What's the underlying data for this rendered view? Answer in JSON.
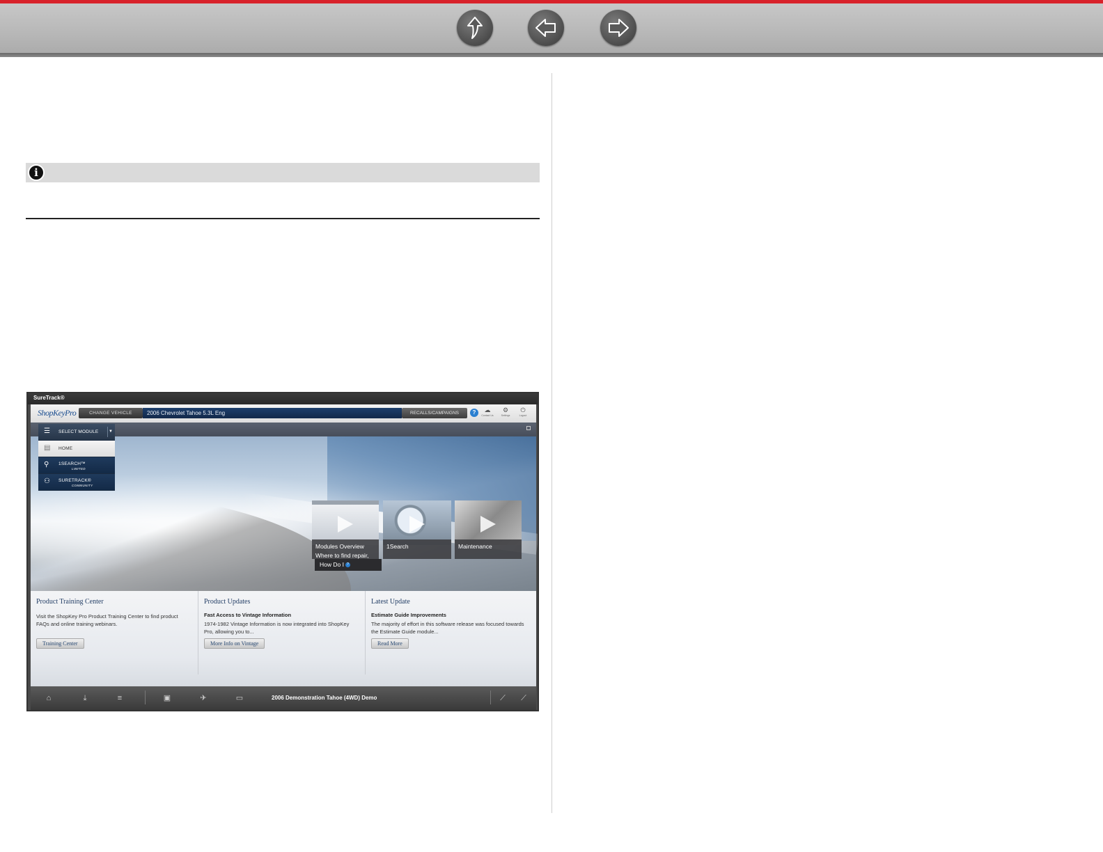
{
  "nav": {
    "up_icon": "up-arrow-icon",
    "back_icon": "left-arrow-icon",
    "forward_icon": "right-arrow-icon",
    "accent_color": "#d8222b"
  },
  "note": {
    "icon": "info-icon",
    "glyph": "i"
  },
  "shot": {
    "window_title": "SureTrack®",
    "logo": "ShopKeyPro",
    "change_vehicle": "CHANGE VEHICLE",
    "vehicle": "2006 Chevrolet Tahoe 5.3L Eng",
    "recalls": "RECALLS/CAMPAIGNS",
    "help": "?",
    "header_icons": [
      {
        "name": "contact-us-icon",
        "label": "Contact Us"
      },
      {
        "name": "settings-icon",
        "label": "Settings"
      },
      {
        "name": "logout-icon",
        "label": "Logout"
      }
    ],
    "menu": {
      "select": "SELECT MODULE",
      "home": "HOME",
      "onesearch": "1SEARCH™",
      "onesearch_sub": "LIMITED",
      "suretrack": "SURETRACK®",
      "suretrack_sub": "COMMUNITY"
    },
    "tiles": [
      {
        "caption1": "Modules Overview",
        "caption2": "Where to find repair,"
      },
      {
        "caption1": "1Search",
        "caption2": ""
      },
      {
        "caption1": "Maintenance",
        "caption2": ""
      }
    ],
    "how_do_i": "How Do I",
    "panels": [
      {
        "title": "Product Training Center",
        "subtitle": "",
        "body": "Visit the ShopKey Pro Product Training Center to find product FAQs and online training webinars.",
        "button": "Training Center"
      },
      {
        "title": "Product Updates",
        "subtitle": "Fast Access to Vintage Information",
        "body": "1974-1982 Vintage Information is now integrated into ShopKey Pro, allowing you to...",
        "button": "More Info on Vintage"
      },
      {
        "title": "Latest Update",
        "subtitle": "Estimate Guide Improvements",
        "body": "The majority of effort in this software release was focused towards the Estimate Guide module...",
        "button": "Read More"
      }
    ],
    "footer_text": "2006 Demonstration Tahoe (4WD) Demo"
  }
}
